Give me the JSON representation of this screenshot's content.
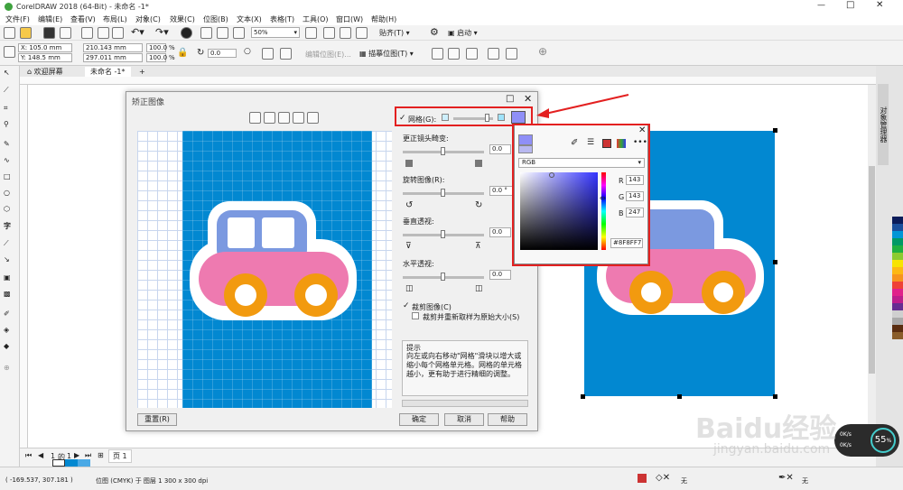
{
  "app": {
    "title": "CorelDRAW 2018 (64-Bit) - 未命名 -1*"
  },
  "menu": [
    "文件(F)",
    "编辑(E)",
    "查看(V)",
    "布局(L)",
    "对象(C)",
    "效果(C)",
    "位图(B)",
    "文本(X)",
    "表格(T)",
    "工具(O)",
    "窗口(W)",
    "帮助(H)"
  ],
  "toolbar": {
    "zoom": "50%",
    "snap_label": "贴齐(T)",
    "launch_label": "启动"
  },
  "props": {
    "x": "X: 105.0 mm",
    "y": "Y: 148.5 mm",
    "w": "210.143 mm",
    "h": "297.011 mm",
    "sx": "100.0",
    "sy": "100.0",
    "pct": "%",
    "angle": "0.0",
    "edit_bitmap": "编辑位图(E)...",
    "trace_bitmap": "描摹位图(T)"
  },
  "tabs": {
    "welcome": "欢迎屏幕",
    "doc": "未命名 -1*"
  },
  "dialog": {
    "title": "矫正图像",
    "grid_label": "网格(G):",
    "correct_label": "更正镜头畸变:",
    "correct_val": "0.0",
    "rotate_label": "旋转图像(R):",
    "rotate_val": "0.0 °",
    "vert_label": "垂直透视:",
    "vert_val": "0.0",
    "horiz_label": "水平透视:",
    "horiz_val": "0.0",
    "crop_label": "裁剪图像(C)",
    "crop_resample_label": "裁剪并重新取样为原始大小(S)",
    "hint_title": "提示",
    "hint_text": "向左或向右移动\"网格\"滑块以增大或缩小每个网格单元格。网格的单元格越小，更有助于进行精细的调整。",
    "reset": "重置(R)",
    "ok": "确定",
    "cancel": "取消",
    "help": "帮助"
  },
  "colorpicker": {
    "model": "RGB",
    "r_label": "R",
    "g_label": "G",
    "b_label": "B",
    "r": "143",
    "g": "143",
    "b": "247",
    "hex": "#8F8FF7",
    "accent": "#8F8FF7"
  },
  "side_panel": {
    "tab_label": "对象管理器"
  },
  "pagebar": {
    "page_num": "1",
    "of_label": "的",
    "total": "1",
    "page_tab": "页 1"
  },
  "status": {
    "coords": "( -169.537, 307.181 )",
    "info": "位图 (CMYK) 于 图层 1 300 x 300 dpi",
    "fill_none": "无",
    "outline_none": "无"
  },
  "speed": {
    "value": "55",
    "unit": "%",
    "up": "0K/s",
    "down": "0K/s"
  },
  "watermark": {
    "logo": "Baidu经验",
    "url": "jingyan.baidu.com"
  },
  "colors": {
    "canvas_blue": "#0288d1",
    "car_body": "#7b99e0",
    "car_pink": "#ee7ab0",
    "wheel": "#f29a0f"
  }
}
